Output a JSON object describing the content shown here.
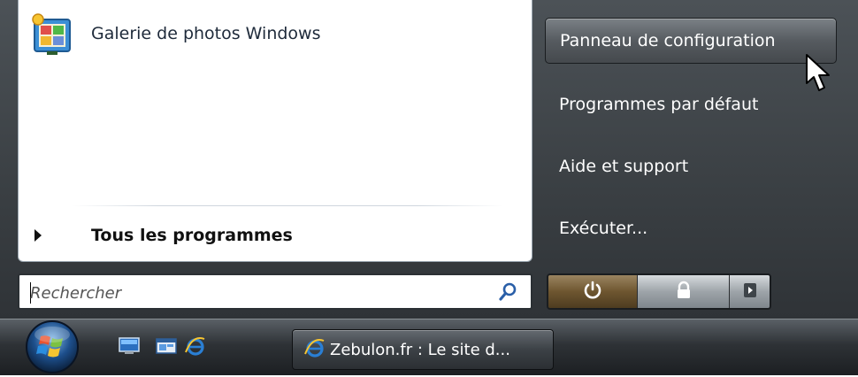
{
  "left_pane": {
    "pinned": [
      {
        "label": "Galerie de photos Windows",
        "icon": "photo-gallery-icon"
      }
    ],
    "all_programs_label": "Tous les programmes"
  },
  "search": {
    "placeholder": "Rechercher",
    "icon": "magnifier-icon"
  },
  "right_pane": {
    "items": [
      {
        "label": "Panneau de configuration",
        "hovered": true
      },
      {
        "label": "Programmes par défaut",
        "hovered": false
      },
      {
        "label": "Aide et support",
        "hovered": false
      },
      {
        "label": "Exécuter...",
        "hovered": false
      }
    ]
  },
  "power_controls": {
    "power_icon": "power-icon",
    "lock_icon": "lock-icon",
    "more_icon": "arrow-right-icon"
  },
  "taskbar": {
    "start_orb_icon": "windows-orb-icon",
    "quick_launch": [
      "show-desktop-icon",
      "switch-windows-icon",
      "internet-explorer-icon"
    ],
    "task_button_label": "Zebulon.fr : Le site d...",
    "task_button_icon": "internet-explorer-icon"
  },
  "colors": {
    "menu_dark": "#3a3f43",
    "power_brown": "#6e5630",
    "ie_blue": "#2a7fd4"
  }
}
